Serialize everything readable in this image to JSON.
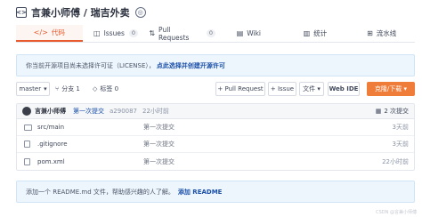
{
  "repo": {
    "icon": "code-bracket-icon",
    "title": "言兼小师傅 / 瑞吉外卖",
    "watch_icon": "watch-icon"
  },
  "tabs": [
    {
      "icon": "</>",
      "label": "代码",
      "count": ""
    },
    {
      "icon": "◫",
      "label": "Issues",
      "count": "0"
    },
    {
      "icon": "⇅",
      "label": "Pull Requests",
      "count": "0"
    },
    {
      "icon": "▤",
      "label": "Wiki",
      "count": ""
    },
    {
      "icon": "▥",
      "label": "统计",
      "count": ""
    },
    {
      "icon": "⊞",
      "label": "流水线",
      "count": ""
    }
  ],
  "license_banner": {
    "text": "你当前开源项目尚未选择许可证（LICENSE），",
    "link": "点此选择并创建开源许可"
  },
  "toolbar": {
    "branch": "master",
    "branch_caret": "▾",
    "branch_count": "分支 1",
    "tag_count": "标签 0",
    "pull_request": "+ Pull Request",
    "issue": "+ Issue",
    "file_menu": "文件 ▾",
    "web_ide": "Web IDE",
    "clone": "克隆/下载 ▾"
  },
  "commit": {
    "author": "言兼小师傅",
    "message": "第一次提交",
    "hash": "a290087",
    "time": "22小时前",
    "count": "2 次提交"
  },
  "files": [
    {
      "type": "folder",
      "name": "src/main",
      "message": "第一次提交",
      "time": "3天前"
    },
    {
      "type": "file",
      "name": ".gitignore",
      "message": "第一次提交",
      "time": "3天前"
    },
    {
      "type": "file",
      "name": "pom.xml",
      "message": "第一次提交",
      "time": "22小时前"
    }
  ],
  "readme_banner": {
    "text": "添加一个 README.md 文件，帮助感兴趣的人了解。",
    "link": "添加 README"
  },
  "watermark": "CSDN @言兼小师傅",
  "colors": {
    "accent": "#e85b2e",
    "clone_button": "#f07c3a",
    "link": "#1a4fa8",
    "banner_bg": "#eef6fd"
  }
}
